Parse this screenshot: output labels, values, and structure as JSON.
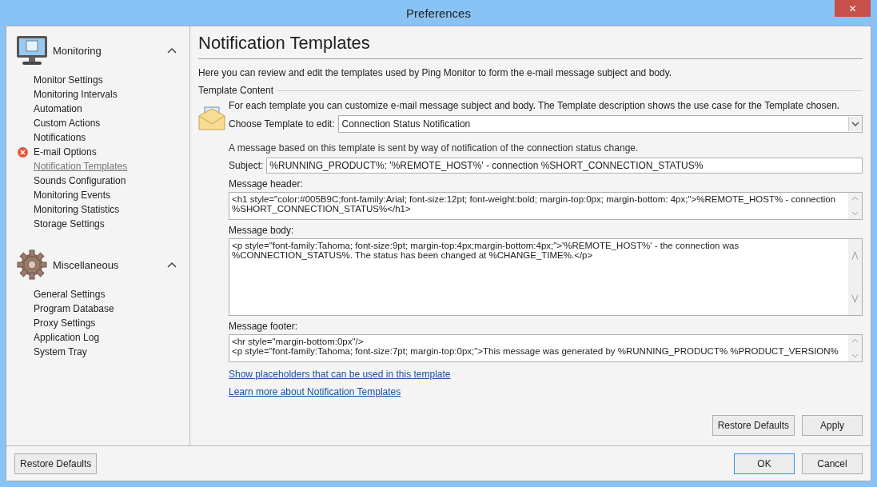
{
  "window": {
    "title": "Preferences",
    "close_label": "✕"
  },
  "sidebar": {
    "groups": [
      {
        "title": "Monitoring",
        "expanded": true,
        "items": [
          {
            "label": "Monitor Settings",
            "selected": false,
            "error": false
          },
          {
            "label": "Monitoring Intervals",
            "selected": false,
            "error": false
          },
          {
            "label": "Automation",
            "selected": false,
            "error": false
          },
          {
            "label": "Custom Actions",
            "selected": false,
            "error": false
          },
          {
            "label": "Notifications",
            "selected": false,
            "error": false
          },
          {
            "label": "E-mail Options",
            "selected": false,
            "error": true
          },
          {
            "label": "Notification Templates",
            "selected": true,
            "error": false
          },
          {
            "label": "Sounds Configuration",
            "selected": false,
            "error": false
          },
          {
            "label": "Monitoring Events",
            "selected": false,
            "error": false
          },
          {
            "label": "Monitoring Statistics",
            "selected": false,
            "error": false
          },
          {
            "label": "Storage Settings",
            "selected": false,
            "error": false
          }
        ]
      },
      {
        "title": "Miscellaneous",
        "expanded": true,
        "items": [
          {
            "label": "General Settings",
            "selected": false,
            "error": false
          },
          {
            "label": "Program Database",
            "selected": false,
            "error": false
          },
          {
            "label": "Proxy Settings",
            "selected": false,
            "error": false
          },
          {
            "label": "Application Log",
            "selected": false,
            "error": false
          },
          {
            "label": "System Tray",
            "selected": false,
            "error": false
          }
        ]
      }
    ]
  },
  "page": {
    "title": "Notification Templates",
    "intro": "Here you can review and edit the templates used by Ping Monitor to form the e-mail message subject and body.",
    "section": "Template Content",
    "section_intro": "For each template you can customize e-mail message subject and body. The Template description shows the use case for the Template chosen.",
    "choose_label": "Choose Template to edit:",
    "choose_value": "Connection Status Notification",
    "description": "A message based on this template is sent by way of notification of the connection status change.",
    "subject_label": "Subject:",
    "subject_value": "%RUNNING_PRODUCT%: '%REMOTE_HOST%' - connection %SHORT_CONNECTION_STATUS%",
    "fields": [
      {
        "label": "Message header:",
        "value": "<h1 style=\"color:#005B9C;font-family:Arial; font-size:12pt; font-weight:bold; margin-top:0px; margin-bottom: 4px;\">%REMOTE_HOST% - connection %SHORT_CONNECTION_STATUS%</h1>"
      },
      {
        "label": "Message body:",
        "value": "<p style=\"font-family:Tahoma; font-size:9pt; margin-top:4px;margin-bottom:4px;\">'%REMOTE_HOST%' - the connection was %CONNECTION_STATUS%. The status has been changed at %CHANGE_TIME%.</p>"
      },
      {
        "label": "Message footer:",
        "value": "<hr style=\"margin-bottom:0px\"/>\n<p style=\"font-family:Tahoma; font-size:7pt; margin-top:0px;\">This message was generated by %RUNNING_PRODUCT% %PRODUCT_VERSION%"
      }
    ],
    "links": [
      "Show placeholders that can be used in this template",
      "Learn more about Notification Templates"
    ],
    "buttons": [
      "Restore Defaults",
      "Apply"
    ]
  },
  "footer": {
    "left_button": "Restore Defaults",
    "ok": "OK",
    "cancel": "Cancel"
  }
}
